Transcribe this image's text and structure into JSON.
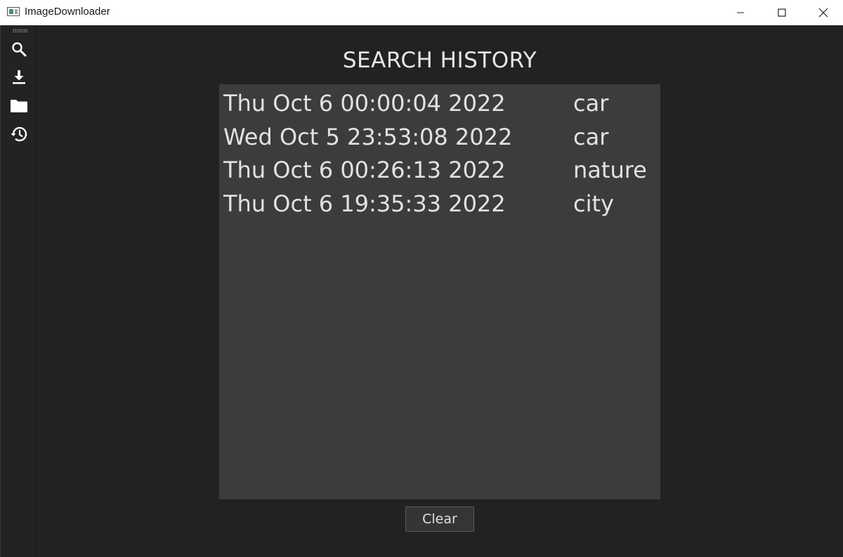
{
  "window": {
    "title": "ImageDownloader"
  },
  "sidebar": {
    "items": [
      {
        "icon": "search-icon"
      },
      {
        "icon": "download-icon"
      },
      {
        "icon": "folder-icon"
      },
      {
        "icon": "history-icon"
      }
    ]
  },
  "main": {
    "title": "SEARCH HISTORY",
    "history": [
      {
        "date": "Thu Oct 6 00:00:04 2022",
        "term": "car"
      },
      {
        "date": "Wed Oct 5 23:53:08 2022",
        "term": "car"
      },
      {
        "date": "Thu Oct 6 00:26:13 2022",
        "term": "nature"
      },
      {
        "date": "Thu Oct 6 19:35:33 2022",
        "term": "city"
      }
    ],
    "clear_label": "Clear"
  },
  "colors": {
    "background": "#222222",
    "list_background": "#3c3c3c",
    "text": "#e2e2e2"
  }
}
